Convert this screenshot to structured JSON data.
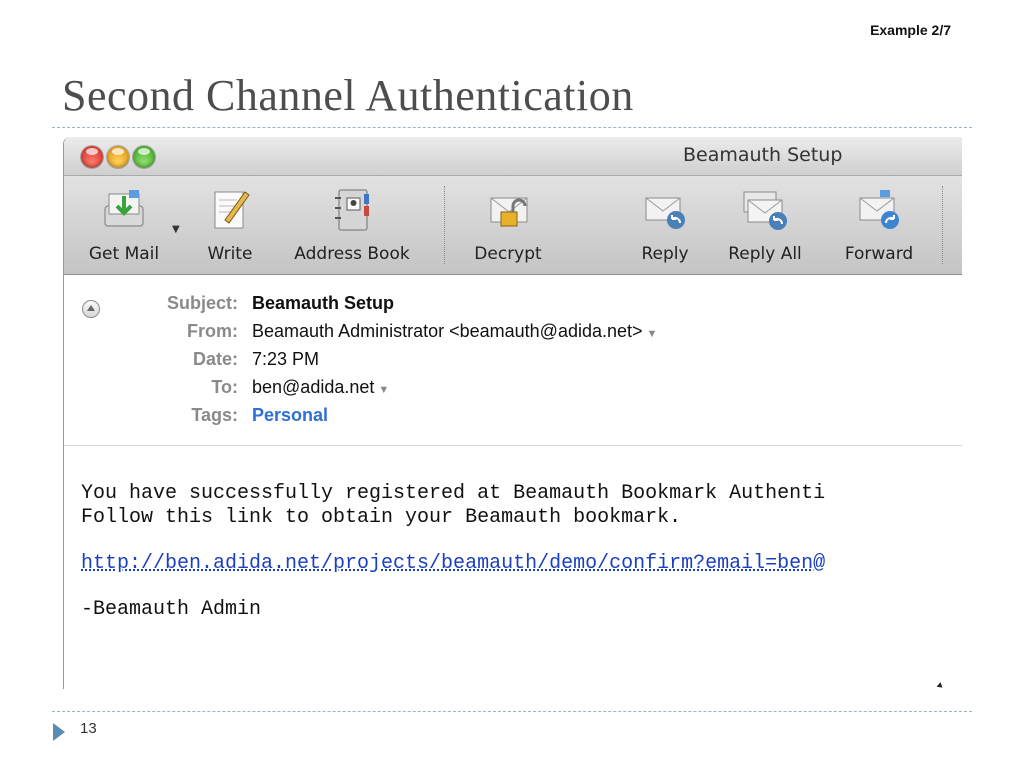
{
  "slide": {
    "example_tag": "Example 2/7",
    "title": "Second Channel Authentication",
    "page_number": "13"
  },
  "window": {
    "title": "Beamauth Setup"
  },
  "toolbar": {
    "items": [
      {
        "label": "Get Mail",
        "icon": "get-mail-icon"
      },
      {
        "label": "Write",
        "icon": "write-icon"
      },
      {
        "label": "Address Book",
        "icon": "address-book-icon"
      },
      {
        "label": "Decrypt",
        "icon": "decrypt-icon"
      },
      {
        "label": "Reply",
        "icon": "reply-icon"
      },
      {
        "label": "Reply All",
        "icon": "reply-all-icon"
      },
      {
        "label": "Forward",
        "icon": "forward-icon"
      }
    ]
  },
  "headers": {
    "subject_label": "Subject:",
    "subject": "Beamauth Setup",
    "from_label": "From:",
    "from": "Beamauth Administrator <beamauth@adida.net>",
    "date_label": "Date:",
    "date": "7:23 PM",
    "to_label": "To:",
    "to": "ben@adida.net",
    "tags_label": "Tags:",
    "tags": "Personal"
  },
  "body": {
    "line1": "You have successfully registered at Beamauth Bookmark Authenti",
    "line2": "Follow this link to obtain your Beamauth bookmark.",
    "link": "http://ben.adida.net/projects/beamauth/demo/confirm?email=ben@",
    "signature": "-Beamauth Admin"
  },
  "colors": {
    "accent": "#5a8bb5",
    "tag": "#2f6fd6",
    "link": "#1a3fc0"
  }
}
